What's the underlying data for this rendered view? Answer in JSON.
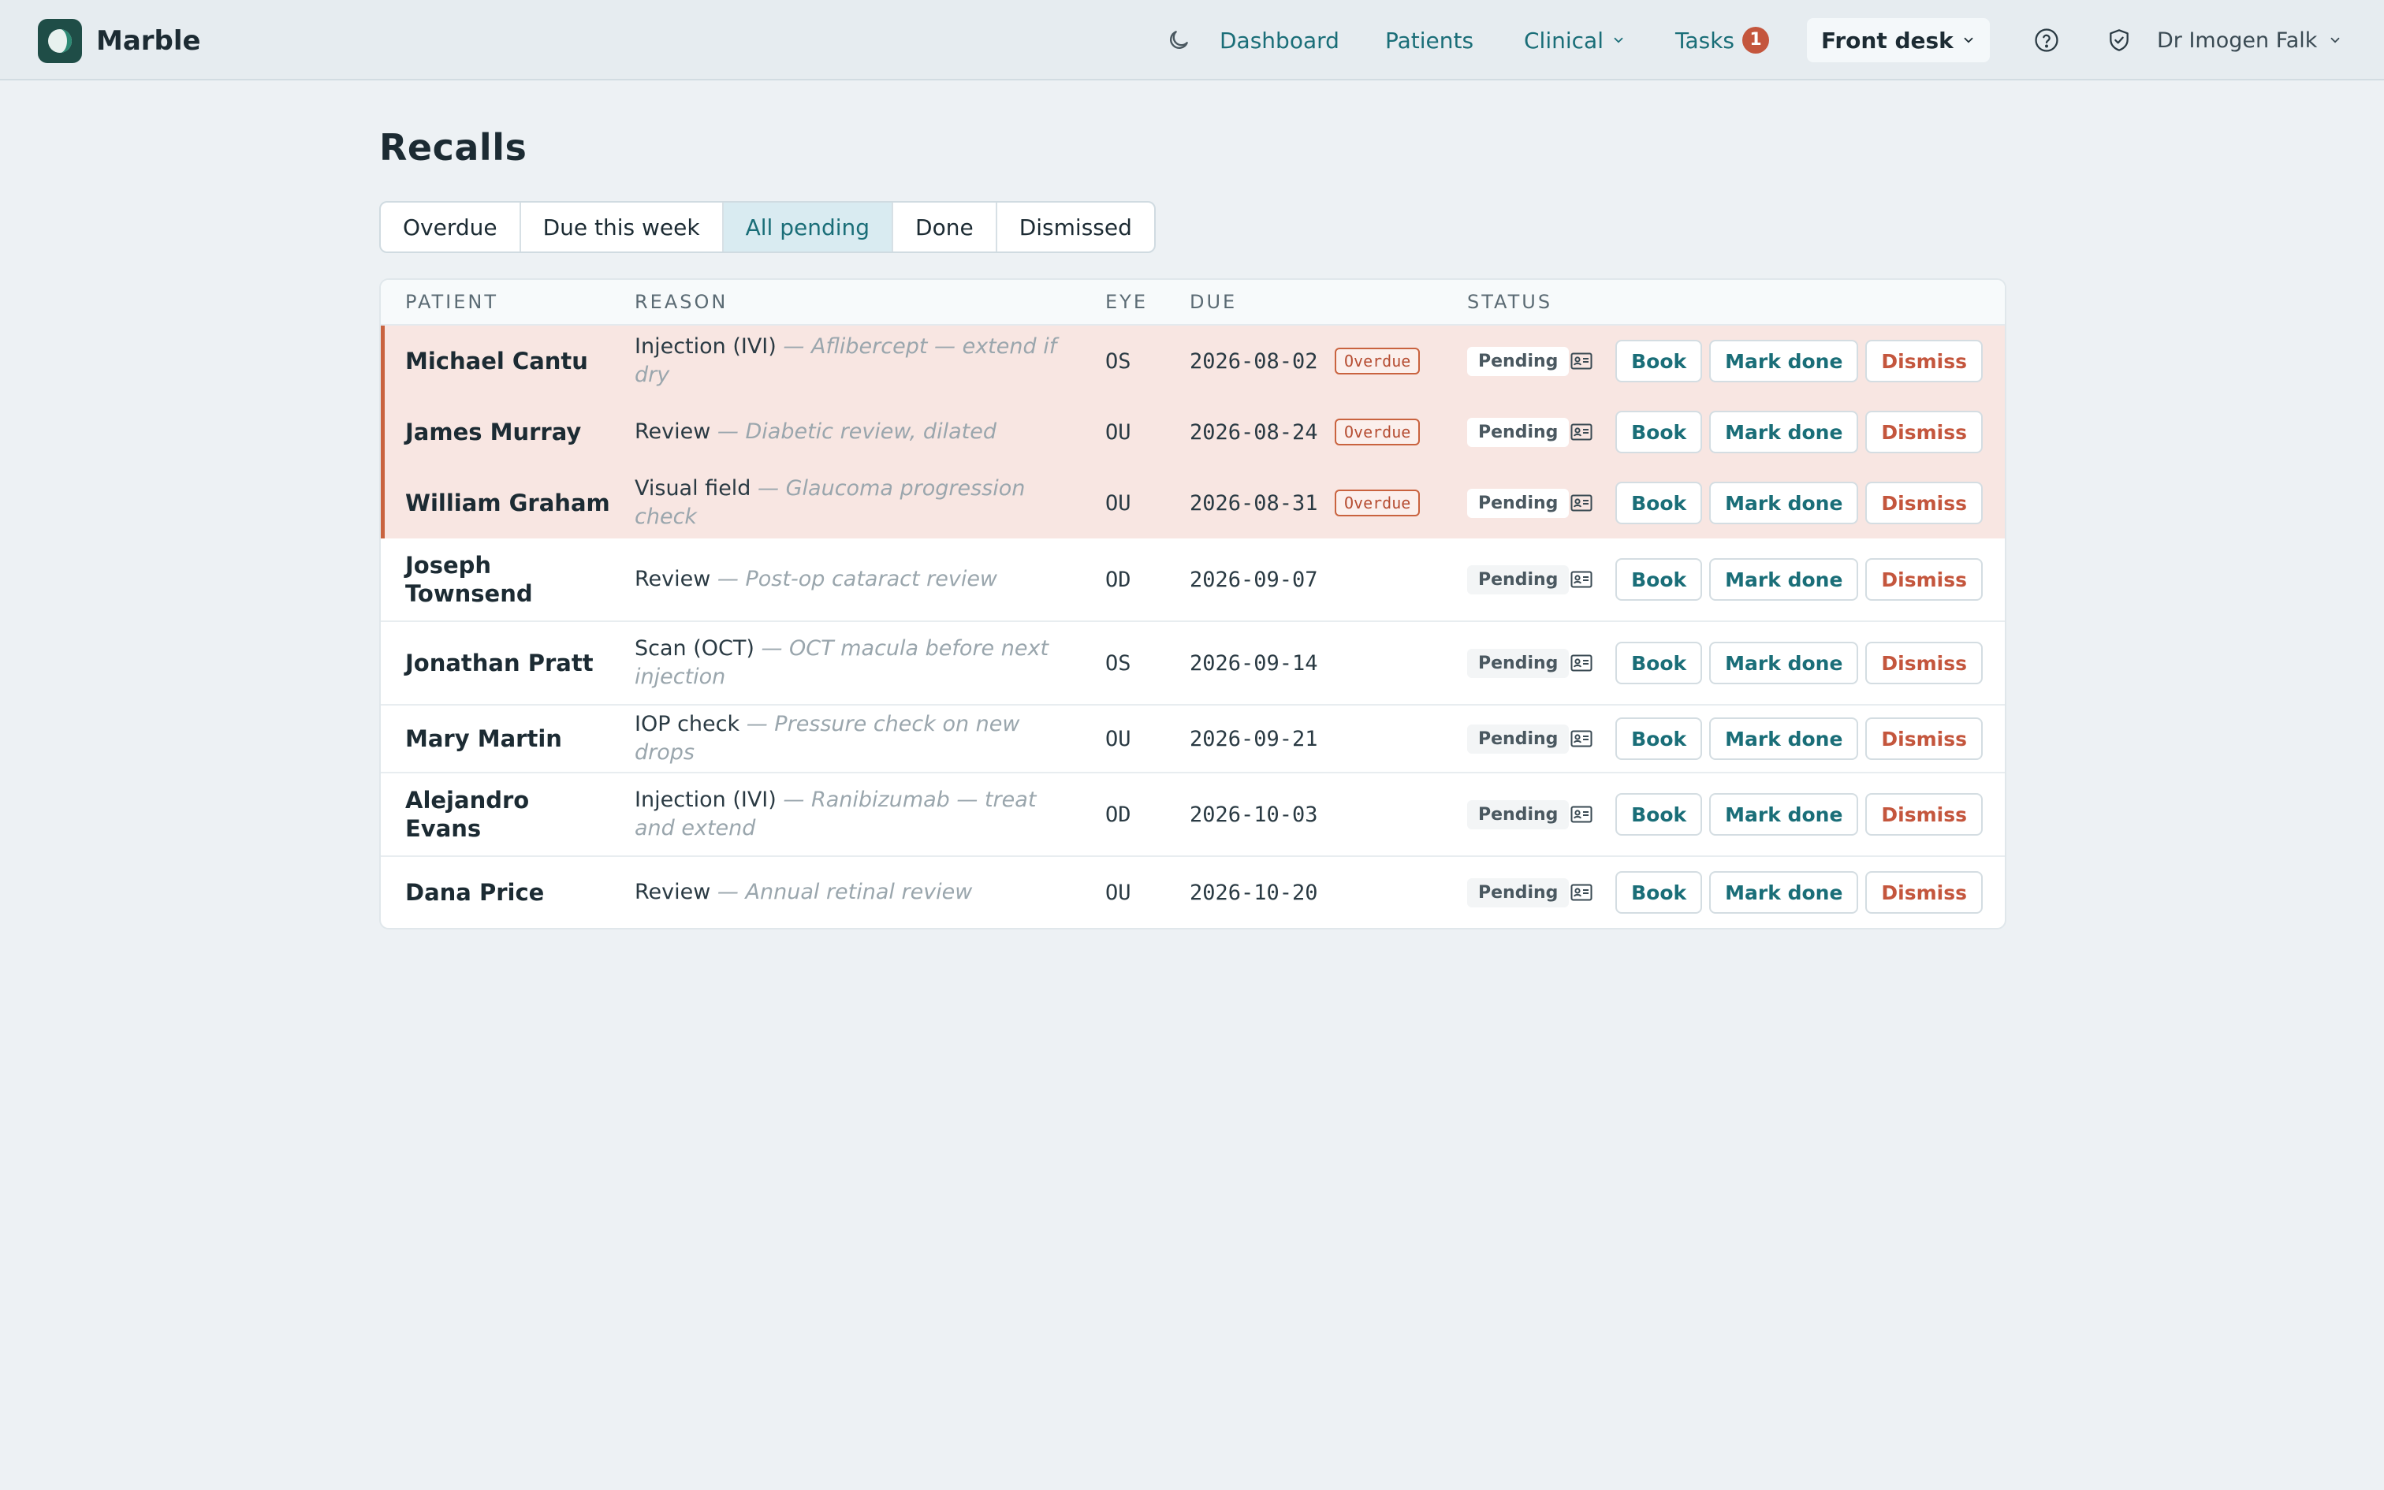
{
  "app": {
    "name": "Marble"
  },
  "nav": {
    "dashboard": "Dashboard",
    "patients": "Patients",
    "clinical": "Clinical",
    "tasks": "Tasks",
    "tasks_badge": "1",
    "front_desk": "Front desk",
    "user": "Dr Imogen Falk"
  },
  "page": {
    "title": "Recalls"
  },
  "tabs": [
    {
      "label": "Overdue"
    },
    {
      "label": "Due this week"
    },
    {
      "label": "All pending",
      "active": true
    },
    {
      "label": "Done"
    },
    {
      "label": "Dismissed"
    }
  ],
  "table": {
    "headers": {
      "patient": "PATIENT",
      "reason": "REASON",
      "eye": "EYE",
      "due": "DUE",
      "status": "STATUS"
    },
    "actions": {
      "book": "Book",
      "mark_done": "Mark done",
      "dismiss": "Dismiss"
    },
    "overdue_label": "Overdue",
    "rows": [
      {
        "patient": "Michael Cantu",
        "reason": "Injection (IVI)",
        "note": " — Aflibercept — extend if dry",
        "eye": "OS",
        "due": "2026-08-02",
        "overdue": true,
        "status": "Pending"
      },
      {
        "patient": "James Murray",
        "reason": "Review",
        "note": " — Diabetic review, dilated",
        "eye": "OU",
        "due": "2026-08-24",
        "overdue": true,
        "status": "Pending"
      },
      {
        "patient": "William Graham",
        "reason": "Visual field",
        "note": " — Glaucoma progression check",
        "eye": "OU",
        "due": "2026-08-31",
        "overdue": true,
        "status": "Pending"
      },
      {
        "patient": "Joseph Townsend",
        "reason": "Review",
        "note": " — Post-op cataract review",
        "eye": "OD",
        "due": "2026-09-07",
        "overdue": false,
        "status": "Pending"
      },
      {
        "patient": "Jonathan Pratt",
        "reason": "Scan (OCT)",
        "note": " — OCT macula before next injection",
        "eye": "OS",
        "due": "2026-09-14",
        "overdue": false,
        "status": "Pending"
      },
      {
        "patient": "Mary Martin",
        "reason": "IOP check",
        "note": " — Pressure check on new drops",
        "eye": "OU",
        "due": "2026-09-21",
        "overdue": false,
        "status": "Pending"
      },
      {
        "patient": "Alejandro Evans",
        "reason": "Injection (IVI)",
        "note": " — Ranibizumab — treat and extend",
        "eye": "OD",
        "due": "2026-10-03",
        "overdue": false,
        "status": "Pending"
      },
      {
        "patient": "Dana Price",
        "reason": "Review",
        "note": " — Annual retinal review",
        "eye": "OU",
        "due": "2026-10-20",
        "overdue": false,
        "status": "Pending"
      }
    ]
  },
  "icons": {
    "logo": "marble-logo-icon",
    "theme": "moon-icon",
    "help": "help-circle-icon",
    "security": "shield-check-icon",
    "patient_card": "id-card-icon",
    "dropdown": "chevron-down-icon"
  },
  "colors": {
    "accent": "#1a6e78",
    "danger": "#c4563d",
    "overdue_row": "#f8e6e2",
    "logo_bg": "#1f4d47"
  }
}
